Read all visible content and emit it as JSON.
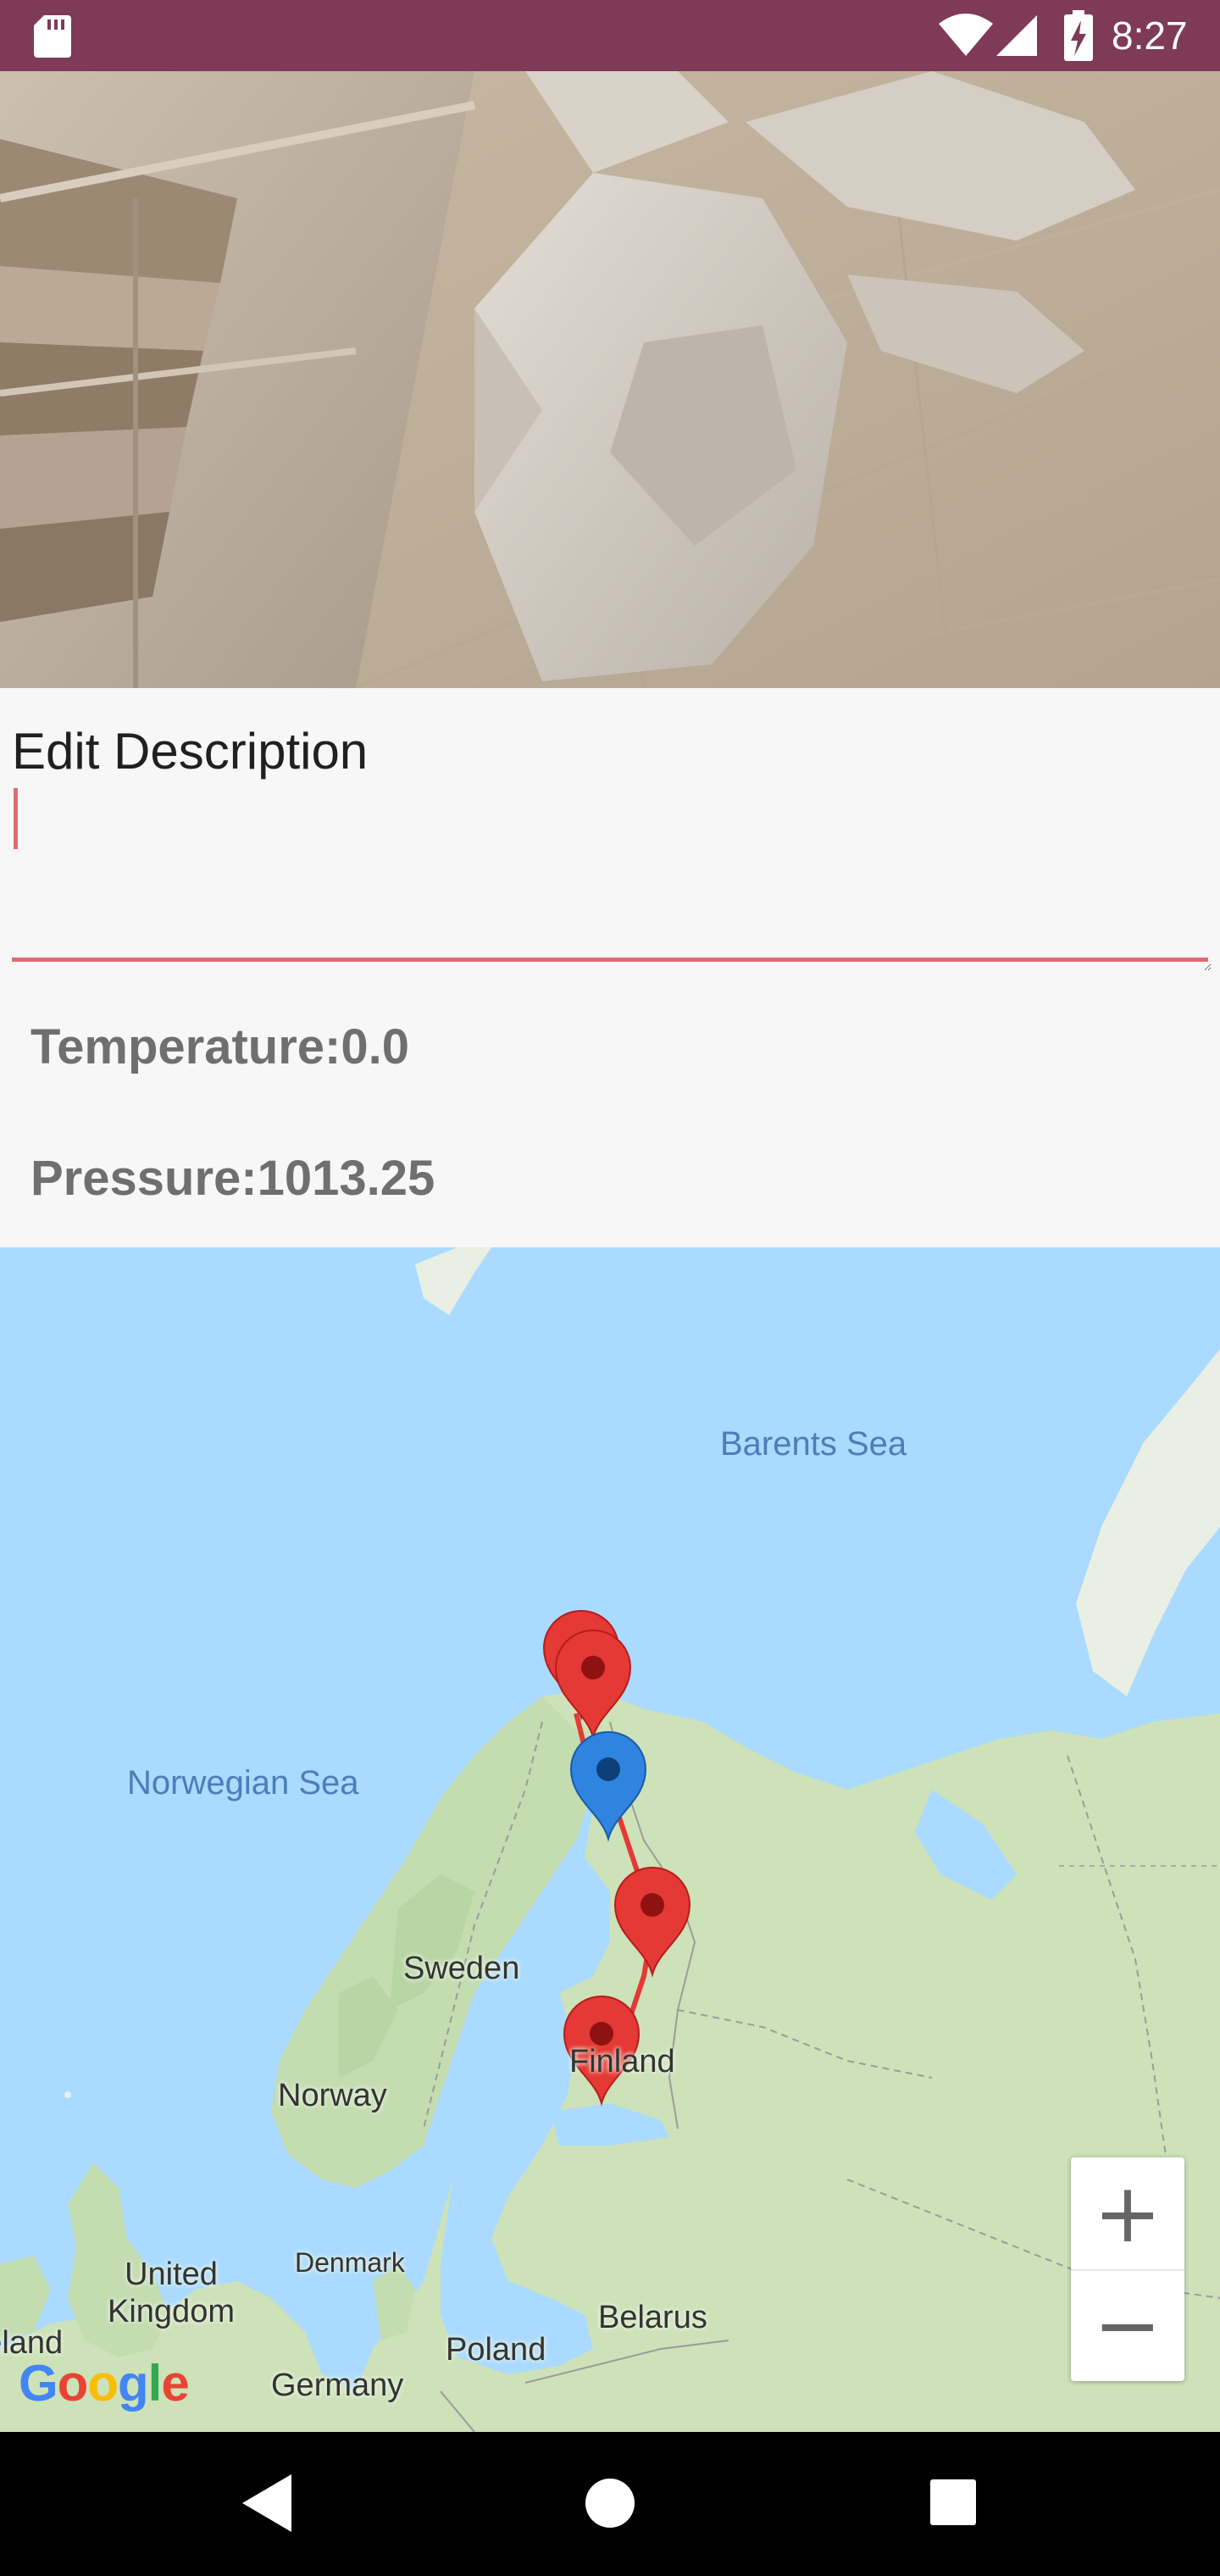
{
  "status_bar": {
    "time": "8:27",
    "icons": [
      "sd-card-icon",
      "wifi-icon",
      "cell-signal-icon",
      "battery-charging-icon"
    ],
    "background_color": "#7e3a56"
  },
  "form": {
    "description_label": "Edit Description",
    "description_value": "",
    "temperature_text": "Temperature:0.0",
    "pressure_text": "Pressure:1013.25",
    "accent_color": "#e06a73"
  },
  "map": {
    "sea_labels": [
      "Barents Sea",
      "Norwegian Sea"
    ],
    "country_labels": [
      "Sweden",
      "Norway",
      "Finland",
      "United Kingdom",
      "Denmark",
      "Poland",
      "Belarus",
      "Germany",
      "Ireland"
    ],
    "markers": [
      {
        "kind": "red-pin-icon"
      },
      {
        "kind": "red-pin-icon"
      },
      {
        "kind": "blue-pin-icon"
      },
      {
        "kind": "red-pin-icon"
      },
      {
        "kind": "red-pin-icon"
      }
    ],
    "zoom_in_label": "+",
    "zoom_out_label": "−",
    "attribution": "Google",
    "route_color": "#e53935",
    "selected_marker_color": "#2f84e0"
  },
  "nav_bar": {
    "icons": [
      "back-icon",
      "home-icon",
      "recents-icon"
    ]
  }
}
